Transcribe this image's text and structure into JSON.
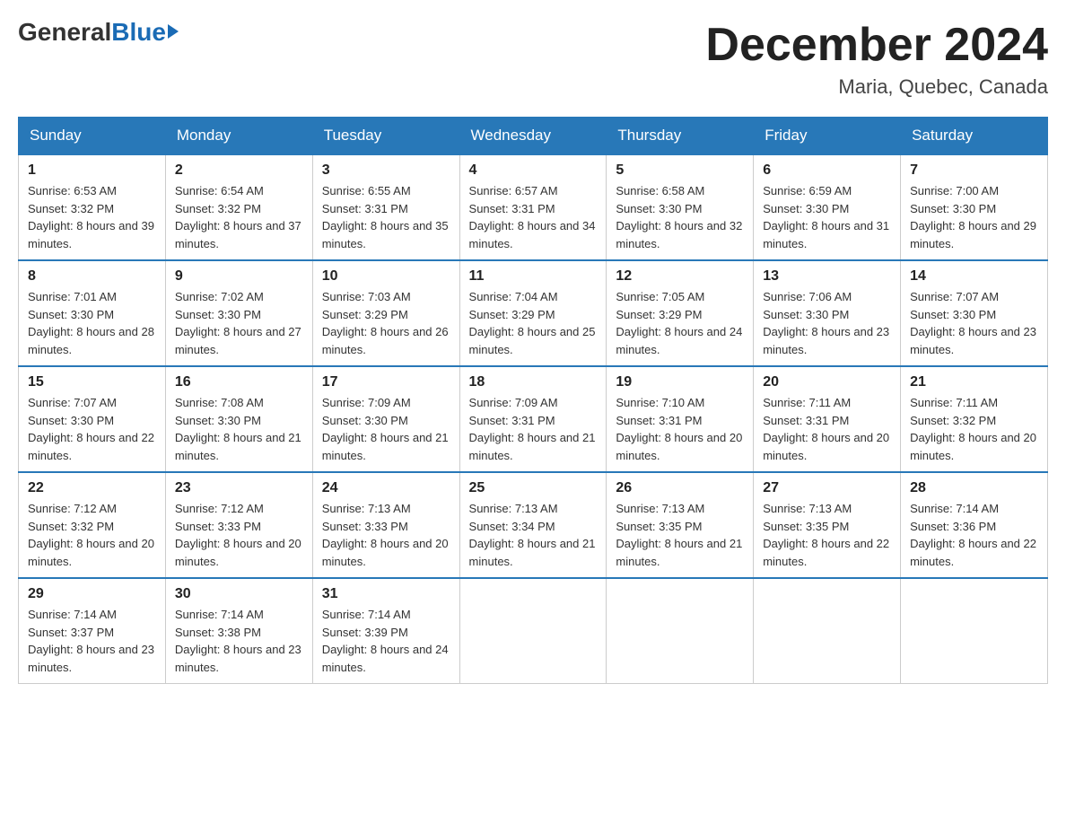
{
  "header": {
    "logo": {
      "general": "General",
      "blue": "Blue"
    },
    "title": "December 2024",
    "location": "Maria, Quebec, Canada"
  },
  "days_of_week": [
    "Sunday",
    "Monday",
    "Tuesday",
    "Wednesday",
    "Thursday",
    "Friday",
    "Saturday"
  ],
  "weeks": [
    [
      {
        "day": "1",
        "sunrise": "6:53 AM",
        "sunset": "3:32 PM",
        "daylight": "8 hours and 39 minutes."
      },
      {
        "day": "2",
        "sunrise": "6:54 AM",
        "sunset": "3:32 PM",
        "daylight": "8 hours and 37 minutes."
      },
      {
        "day": "3",
        "sunrise": "6:55 AM",
        "sunset": "3:31 PM",
        "daylight": "8 hours and 35 minutes."
      },
      {
        "day": "4",
        "sunrise": "6:57 AM",
        "sunset": "3:31 PM",
        "daylight": "8 hours and 34 minutes."
      },
      {
        "day": "5",
        "sunrise": "6:58 AM",
        "sunset": "3:30 PM",
        "daylight": "8 hours and 32 minutes."
      },
      {
        "day": "6",
        "sunrise": "6:59 AM",
        "sunset": "3:30 PM",
        "daylight": "8 hours and 31 minutes."
      },
      {
        "day": "7",
        "sunrise": "7:00 AM",
        "sunset": "3:30 PM",
        "daylight": "8 hours and 29 minutes."
      }
    ],
    [
      {
        "day": "8",
        "sunrise": "7:01 AM",
        "sunset": "3:30 PM",
        "daylight": "8 hours and 28 minutes."
      },
      {
        "day": "9",
        "sunrise": "7:02 AM",
        "sunset": "3:30 PM",
        "daylight": "8 hours and 27 minutes."
      },
      {
        "day": "10",
        "sunrise": "7:03 AM",
        "sunset": "3:29 PM",
        "daylight": "8 hours and 26 minutes."
      },
      {
        "day": "11",
        "sunrise": "7:04 AM",
        "sunset": "3:29 PM",
        "daylight": "8 hours and 25 minutes."
      },
      {
        "day": "12",
        "sunrise": "7:05 AM",
        "sunset": "3:29 PM",
        "daylight": "8 hours and 24 minutes."
      },
      {
        "day": "13",
        "sunrise": "7:06 AM",
        "sunset": "3:30 PM",
        "daylight": "8 hours and 23 minutes."
      },
      {
        "day": "14",
        "sunrise": "7:07 AM",
        "sunset": "3:30 PM",
        "daylight": "8 hours and 23 minutes."
      }
    ],
    [
      {
        "day": "15",
        "sunrise": "7:07 AM",
        "sunset": "3:30 PM",
        "daylight": "8 hours and 22 minutes."
      },
      {
        "day": "16",
        "sunrise": "7:08 AM",
        "sunset": "3:30 PM",
        "daylight": "8 hours and 21 minutes."
      },
      {
        "day": "17",
        "sunrise": "7:09 AM",
        "sunset": "3:30 PM",
        "daylight": "8 hours and 21 minutes."
      },
      {
        "day": "18",
        "sunrise": "7:09 AM",
        "sunset": "3:31 PM",
        "daylight": "8 hours and 21 minutes."
      },
      {
        "day": "19",
        "sunrise": "7:10 AM",
        "sunset": "3:31 PM",
        "daylight": "8 hours and 20 minutes."
      },
      {
        "day": "20",
        "sunrise": "7:11 AM",
        "sunset": "3:31 PM",
        "daylight": "8 hours and 20 minutes."
      },
      {
        "day": "21",
        "sunrise": "7:11 AM",
        "sunset": "3:32 PM",
        "daylight": "8 hours and 20 minutes."
      }
    ],
    [
      {
        "day": "22",
        "sunrise": "7:12 AM",
        "sunset": "3:32 PM",
        "daylight": "8 hours and 20 minutes."
      },
      {
        "day": "23",
        "sunrise": "7:12 AM",
        "sunset": "3:33 PM",
        "daylight": "8 hours and 20 minutes."
      },
      {
        "day": "24",
        "sunrise": "7:13 AM",
        "sunset": "3:33 PM",
        "daylight": "8 hours and 20 minutes."
      },
      {
        "day": "25",
        "sunrise": "7:13 AM",
        "sunset": "3:34 PM",
        "daylight": "8 hours and 21 minutes."
      },
      {
        "day": "26",
        "sunrise": "7:13 AM",
        "sunset": "3:35 PM",
        "daylight": "8 hours and 21 minutes."
      },
      {
        "day": "27",
        "sunrise": "7:13 AM",
        "sunset": "3:35 PM",
        "daylight": "8 hours and 22 minutes."
      },
      {
        "day": "28",
        "sunrise": "7:14 AM",
        "sunset": "3:36 PM",
        "daylight": "8 hours and 22 minutes."
      }
    ],
    [
      {
        "day": "29",
        "sunrise": "7:14 AM",
        "sunset": "3:37 PM",
        "daylight": "8 hours and 23 minutes."
      },
      {
        "day": "30",
        "sunrise": "7:14 AM",
        "sunset": "3:38 PM",
        "daylight": "8 hours and 23 minutes."
      },
      {
        "day": "31",
        "sunrise": "7:14 AM",
        "sunset": "3:39 PM",
        "daylight": "8 hours and 24 minutes."
      },
      null,
      null,
      null,
      null
    ]
  ],
  "labels": {
    "sunrise": "Sunrise:",
    "sunset": "Sunset:",
    "daylight": "Daylight:"
  }
}
